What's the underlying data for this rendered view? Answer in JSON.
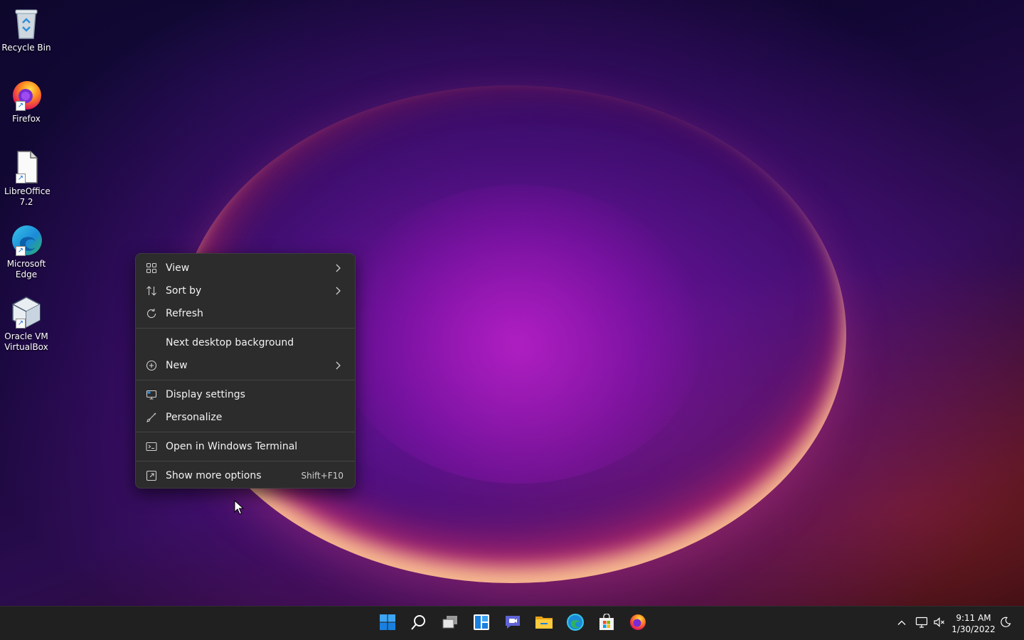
{
  "desktop": {
    "icons": [
      {
        "label": "Recycle Bin",
        "icon": "recycle-bin-icon"
      },
      {
        "label": "Firefox",
        "icon": "firefox-icon"
      },
      {
        "label": "LibreOffice 7.2",
        "icon": "libreoffice-icon"
      },
      {
        "label": "Microsoft Edge",
        "icon": "edge-icon"
      },
      {
        "label": "Oracle VM VirtualBox",
        "icon": "virtualbox-icon"
      }
    ]
  },
  "context_menu": {
    "items": [
      {
        "label": "View",
        "icon": "grid-view-icon",
        "submenu": true
      },
      {
        "label": "Sort by",
        "icon": "sort-icon",
        "submenu": true
      },
      {
        "label": "Refresh",
        "icon": "refresh-icon"
      },
      {
        "label": "Next desktop background",
        "icon": ""
      },
      {
        "label": "New",
        "icon": "plus-circle-icon",
        "submenu": true
      },
      {
        "label": "Display settings",
        "icon": "display-icon"
      },
      {
        "label": "Personalize",
        "icon": "brush-icon"
      },
      {
        "label": "Open in Windows Terminal",
        "icon": "terminal-icon"
      },
      {
        "label": "Show more options",
        "icon": "expand-icon",
        "shortcut": "Shift+F10"
      }
    ]
  },
  "taskbar": {
    "apps": [
      "start-icon",
      "search-icon",
      "task-view-icon",
      "widgets-icon",
      "chat-icon",
      "file-explorer-icon",
      "edge-icon",
      "store-icon",
      "firefox-icon"
    ],
    "tray": [
      "chevron-up-icon",
      "network-icon",
      "volume-muted-icon"
    ],
    "clock": {
      "time": "9:11 AM",
      "date": "1/30/2022"
    },
    "notification_icon": "moon-icon"
  },
  "colors": {
    "menu_bg": "#2c2c2c",
    "taskbar_bg": "#202020",
    "accent": "#0078d4"
  }
}
